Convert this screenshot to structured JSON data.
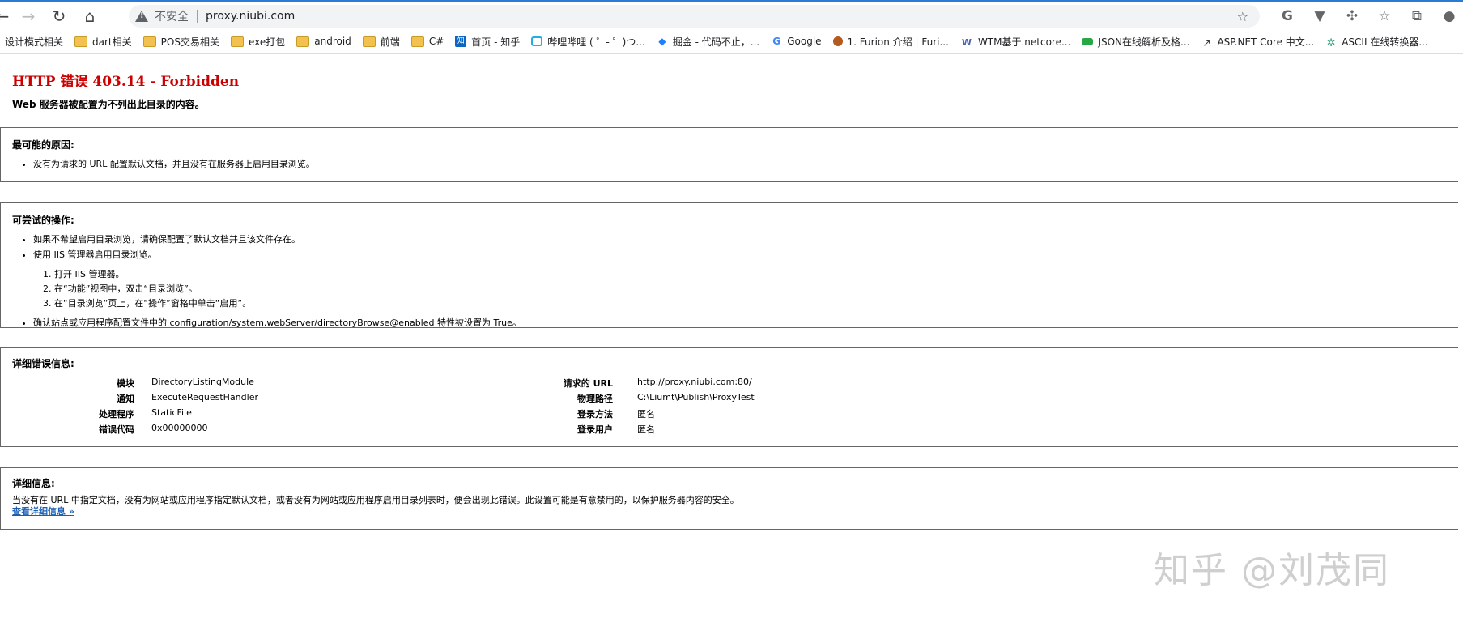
{
  "browser": {
    "insecure_label": "不安全",
    "url": "proxy.niubi.com",
    "bookmarks": [
      {
        "label": "设计模式相关",
        "icon": "none"
      },
      {
        "label": "dart相关",
        "icon": "folder-icon"
      },
      {
        "label": "POS交易相关",
        "icon": "folder-icon"
      },
      {
        "label": "exe打包",
        "icon": "folder-icon"
      },
      {
        "label": "android",
        "icon": "folder-icon"
      },
      {
        "label": "前端",
        "icon": "folder-icon"
      },
      {
        "label": "C#",
        "icon": "folder-icon"
      },
      {
        "label": "首页 - 知乎",
        "icon": "zhihu-icon"
      },
      {
        "label": "哔哩哔哩 ( ゜- ゜)つ...",
        "icon": "bilibili-icon"
      },
      {
        "label": "掘金 - 代码不止，...",
        "icon": "juejin-icon"
      },
      {
        "label": "Google",
        "icon": "google-icon"
      },
      {
        "label": "1. Furion 介绍 | Furi...",
        "icon": "furion-icon"
      },
      {
        "label": "WTM基于.netcore...",
        "icon": "wtm-icon"
      },
      {
        "label": "JSON在线解析及格...",
        "icon": "json-icon"
      },
      {
        "label": "ASP.NET Core 中文...",
        "icon": "aspnet-icon"
      },
      {
        "label": "ASCII 在线转换器...",
        "icon": "gear-icon"
      }
    ]
  },
  "error": {
    "title": "HTTP 错误 403.14 - Forbidden",
    "subtitle": "Web 服务器被配置为不列出此目录的内容。"
  },
  "causes": {
    "title": "最可能的原因:",
    "items": [
      "没有为请求的 URL 配置默认文档，并且没有在服务器上启用目录浏览。"
    ]
  },
  "actions": {
    "title": "可尝试的操作:",
    "items": [
      "如果不希望启用目录浏览，请确保配置了默认文档并且该文件存在。",
      "使用 IIS 管理器启用目录浏览。",
      "确认站点或应用程序配置文件中的 configuration/system.webServer/directoryBrowse@enabled 特性被设置为 True。"
    ],
    "steps": [
      "打开 IIS 管理器。",
      "在“功能”视图中，双击“目录浏览”。",
      "在“目录浏览”页上，在“操作”窗格中单击“启用”。"
    ]
  },
  "details": {
    "title": "详细错误信息:",
    "left": [
      {
        "label": "模块",
        "value": "DirectoryListingModule"
      },
      {
        "label": "通知",
        "value": "ExecuteRequestHandler"
      },
      {
        "label": "处理程序",
        "value": "StaticFile"
      },
      {
        "label": "错误代码",
        "value": "0x00000000"
      }
    ],
    "right": [
      {
        "label": "请求的 URL",
        "value": "http://proxy.niubi.com:80/"
      },
      {
        "label": "物理路径",
        "value": "C:\\Liumt\\Publish\\ProxyTest"
      },
      {
        "label": "登录方法",
        "value": "匿名"
      },
      {
        "label": "登录用户",
        "value": "匿名"
      }
    ]
  },
  "info": {
    "title": "详细信息:",
    "text": "当没有在 URL 中指定文档，没有为网站或应用程序指定默认文档，或者没有为网站或应用程序启用目录列表时，便会出现此错误。此设置可能是有意禁用的，以保护服务器内容的安全。",
    "link": "查看详细信息 »"
  },
  "watermark": "知乎 @刘茂同"
}
